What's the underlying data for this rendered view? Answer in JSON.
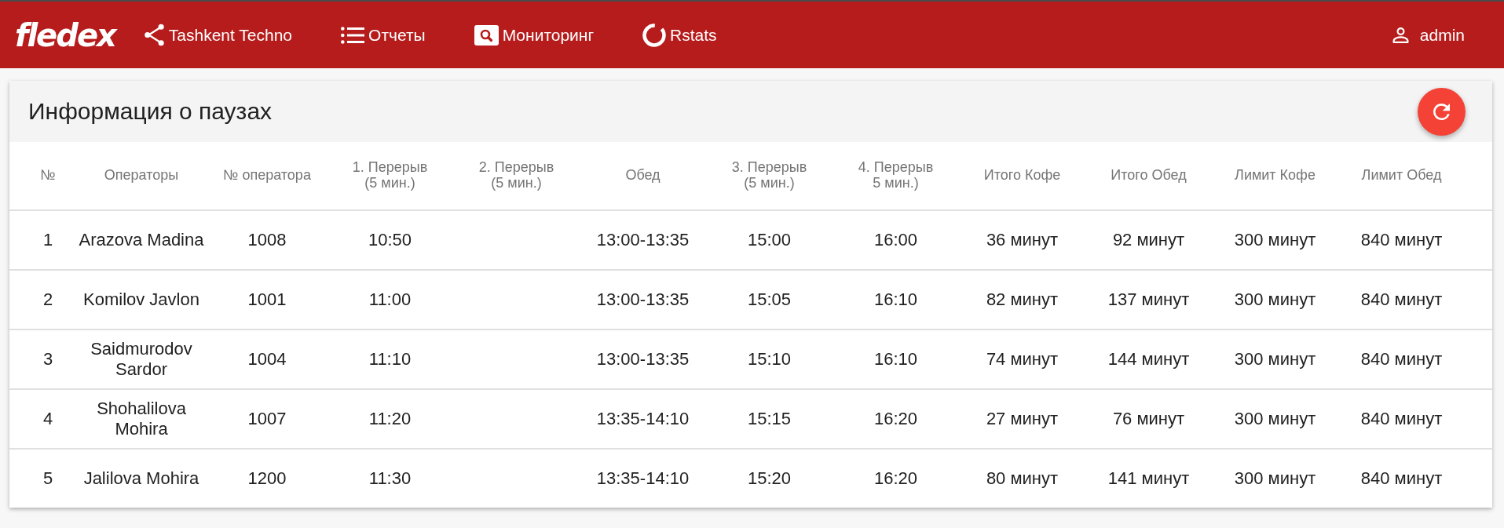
{
  "header": {
    "logo": "fledex",
    "nav": [
      {
        "kind": "share",
        "label": "Tashkent Techno"
      },
      {
        "kind": "list",
        "label": "Отчеты"
      },
      {
        "kind": "search",
        "label": "Мониторинг"
      },
      {
        "kind": "ring",
        "label": "Rstats"
      }
    ],
    "user": "admin"
  },
  "card": {
    "title": "Информация о паузах",
    "table": {
      "columns": [
        "№",
        "Операторы",
        "№ оператора",
        "1. Перерыв\n(5 мин.)",
        "2. Перерыв\n(5 мин.)",
        "Обед",
        "3. Перерыв\n(5 мин.)",
        "4. Перерыв\n5 мин.)",
        "Итого Кофе",
        "Итого Обед",
        "Лимит Кофе",
        "Лимит Обед"
      ],
      "rows": [
        {
          "number": "1",
          "operator": "Arazova Madina",
          "operator_number": "1008",
          "break_1": "10:50",
          "lunch": "13:00-13:35",
          "break_3": "15:00",
          "break_4": "16:00",
          "coffee_total": "36 минут",
          "lunch_total": "92 минут",
          "coffee_limit": "300 минут",
          "lunch_limit": "840 минут"
        },
        {
          "number": "2",
          "operator": "Komilov Javlon",
          "operator_number": "1001",
          "break_1": "11:00",
          "lunch": "13:00-13:35",
          "break_3": "15:05",
          "break_4": "16:10",
          "coffee_total": "82 минут",
          "lunch_total": "137 минут",
          "coffee_limit": "300 минут",
          "lunch_limit": "840 минут"
        },
        {
          "number": "3",
          "operator": "Saidmurodov Sardor",
          "operator_number": "1004",
          "break_1": "11:10",
          "lunch": "13:00-13:35",
          "break_3": "15:10",
          "break_4": "16:10",
          "coffee_total": "74 минут",
          "lunch_total": "144 минут",
          "coffee_limit": "300 минут",
          "lunch_limit": "840 минут"
        },
        {
          "number": "4",
          "operator": "Shohalilova Mohira",
          "operator_number": "1007",
          "break_1": "11:20",
          "lunch": "13:35-14:10",
          "break_3": "15:15",
          "break_4": "16:20",
          "coffee_total": "27 минут",
          "lunch_total": "76 минут",
          "coffee_limit": "300 минут",
          "lunch_limit": "840 минут"
        },
        {
          "number": "5",
          "operator": "Jalilova Mohira",
          "operator_number": "1200",
          "break_1": "11:30",
          "lunch": "13:35-14:10",
          "break_3": "15:20",
          "break_4": "16:20",
          "coffee_total": "80 минут",
          "lunch_total": "141 минут",
          "coffee_limit": "300 минут",
          "lunch_limit": "840 минут"
        }
      ]
    }
  }
}
